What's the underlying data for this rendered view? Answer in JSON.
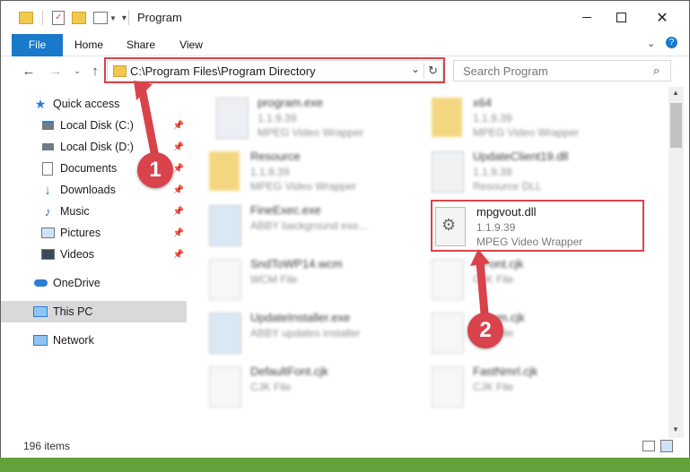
{
  "window": {
    "title": "Program"
  },
  "ribbon": {
    "tabs": [
      "File",
      "Home",
      "Share",
      "View"
    ]
  },
  "address": {
    "path": "C:\\Program Files\\Program Directory"
  },
  "search": {
    "placeholder": "Search Program"
  },
  "sidebar": {
    "items": [
      {
        "label": "Quick access",
        "icon": "star-icon"
      },
      {
        "label": "Local Disk (C:)",
        "icon": "drive-icon"
      },
      {
        "label": "Local Disk (D:)",
        "icon": "drive-icon"
      },
      {
        "label": "Documents",
        "icon": "documents-icon"
      },
      {
        "label": "Downloads",
        "icon": "download-icon"
      },
      {
        "label": "Music",
        "icon": "music-icon"
      },
      {
        "label": "Pictures",
        "icon": "pictures-icon"
      },
      {
        "label": "Videos",
        "icon": "videos-icon"
      },
      {
        "label": "OneDrive",
        "icon": "cloud-icon"
      },
      {
        "label": "This PC",
        "icon": "computer-icon"
      },
      {
        "label": "Network",
        "icon": "network-icon"
      }
    ]
  },
  "files": [
    {
      "name": "program.exe",
      "ver": "1.1.9.39",
      "desc": "MPEG Video Wrapper"
    },
    {
      "name": "x64",
      "ver": "1.1.9.39",
      "desc": "MPEG Video Wrapper"
    },
    {
      "name": "Resource",
      "ver": "1.1.9.39",
      "desc": "MPEG Video Wrapper"
    },
    {
      "name": "UpdateClient19.dll",
      "ver": "1.1.9.39",
      "desc": "Resource DLL"
    },
    {
      "name": "FineExec.exe",
      "ver": "",
      "desc": "ABBY background exe..."
    },
    {
      "name": "mpgvout.dll",
      "ver": "1.1.9.39",
      "desc": "MPEG Video Wrapper"
    },
    {
      "name": "SndToWP14.wcm",
      "ver": "",
      "desc": "WCM File"
    },
    {
      "name": "...Font.cjk",
      "ver": "",
      "desc": "CJK File"
    },
    {
      "name": "UpdateInstaller.exe",
      "ver": "",
      "desc": "ABBY updates installer"
    },
    {
      "name": "...Num.cjk",
      "ver": "",
      "desc": "CJK File"
    },
    {
      "name": "DefaultFont.cjk",
      "ver": "",
      "desc": "CJK File"
    },
    {
      "name": "FastNmrl.cjk",
      "ver": "",
      "desc": "CJK File"
    }
  ],
  "callouts": {
    "one": "1",
    "two": "2"
  },
  "status": {
    "count": "196 items"
  },
  "colors": {
    "accent": "#1979ca",
    "highlight": "#d9434b",
    "bottom": "#63a13b"
  }
}
